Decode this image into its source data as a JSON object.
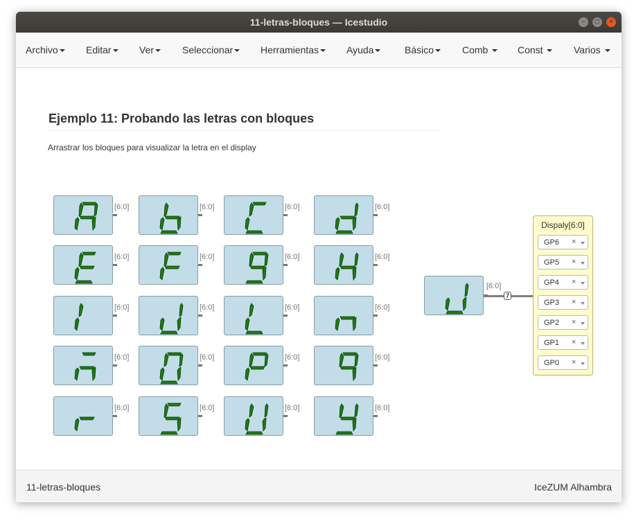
{
  "window": {
    "title": "11-letras-bloques — Icestudio",
    "controls": [
      "–",
      "□",
      "×"
    ]
  },
  "menu": [
    {
      "label": "Archivo"
    },
    {
      "label": "Editar"
    },
    {
      "label": "Ver"
    },
    {
      "label": "Seleccionar"
    },
    {
      "label": "Herramientas"
    },
    {
      "label": "Ayuda"
    },
    {
      "label": "Básico"
    },
    {
      "label": "Comb"
    },
    {
      "label": "Const"
    },
    {
      "label": "Varios"
    }
  ],
  "page": {
    "title": "Ejemplo 11: Probando las letras con bloques",
    "description": "Arrastrar los bloques para visualizar la letra en el display"
  },
  "letter_blocks": [
    {
      "letter": "A",
      "segments": "abcefg",
      "port": "[6:0]"
    },
    {
      "letter": "b",
      "segments": "cdefg",
      "port": "[6:0]"
    },
    {
      "letter": "C",
      "segments": "adef",
      "port": "[6:0]"
    },
    {
      "letter": "d",
      "segments": "bcdeg",
      "port": "[6:0]"
    },
    {
      "letter": "E",
      "segments": "adefg",
      "port": "[6:0]"
    },
    {
      "letter": "F",
      "segments": "aefg",
      "port": "[6:0]"
    },
    {
      "letter": "g",
      "segments": "abcdfg",
      "port": "[6:0]"
    },
    {
      "letter": "H",
      "segments": "bcefg",
      "port": "[6:0]"
    },
    {
      "letter": "I",
      "segments": "ef",
      "port": "[6:0]"
    },
    {
      "letter": "u",
      "segments": "bcde",
      "port": "[6:0]"
    },
    {
      "letter": "L",
      "segments": "def",
      "port": "[6:0]"
    },
    {
      "letter": "n",
      "segments": "ceg",
      "port": "[6:0]"
    },
    {
      "letter": "ñ",
      "segments": "aceg",
      "port": "[6:0]"
    },
    {
      "letter": "O",
      "segments": "abcdef",
      "port": "[6:0]"
    },
    {
      "letter": "P",
      "segments": "abefg",
      "port": "[6:0]"
    },
    {
      "letter": "q",
      "segments": "abcfg",
      "port": "[6:0]"
    },
    {
      "letter": "r",
      "segments": "eg",
      "port": "[6:0]"
    },
    {
      "letter": "S",
      "segments": "acdfg",
      "port": "[6:0]"
    },
    {
      "letter": "U",
      "segments": "bcdef",
      "port": "[6:0]"
    },
    {
      "letter": "y",
      "segments": "bcdfg",
      "port": "[6:0]"
    }
  ],
  "active_block": {
    "letter": "J",
    "segments": "bcde",
    "port": "[6:0]",
    "bus_width": "7"
  },
  "output": {
    "label": "Dispaly[6:0]",
    "pins": [
      "GP6",
      "GP5",
      "GP4",
      "GP3",
      "GP2",
      "GP1",
      "GP0"
    ],
    "clear_symbol": "×"
  },
  "footer": {
    "left": "11-letras-bloques",
    "right": "IceZUM Alhambra"
  },
  "colors": {
    "segment_on": "#1e7a14",
    "segment_edge": "#0b3d06",
    "block_bg": "#c2dde8",
    "output_bg": "#fffbcc"
  }
}
